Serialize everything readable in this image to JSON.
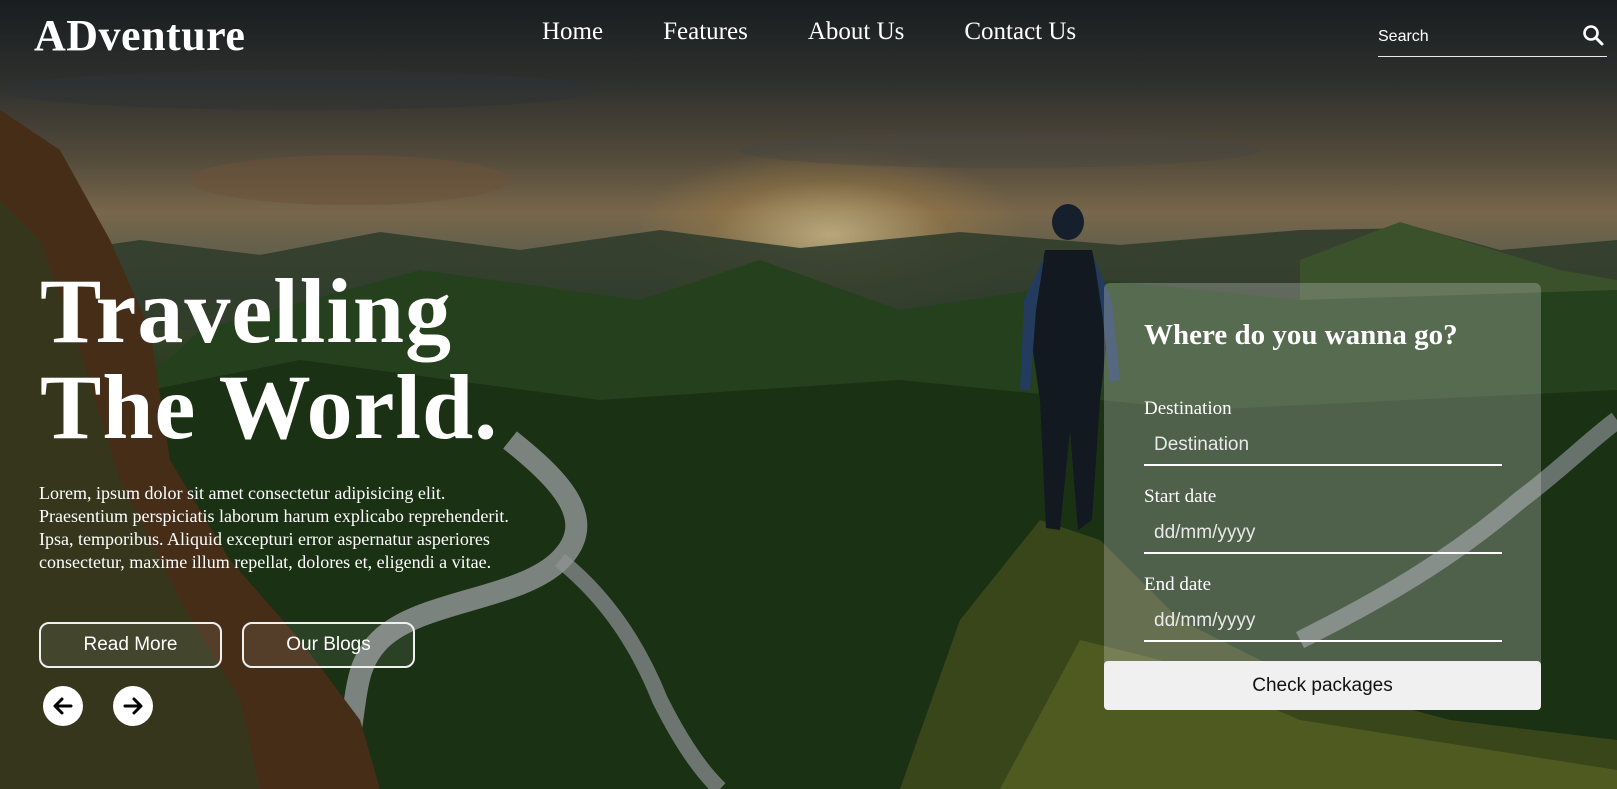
{
  "header": {
    "logo": "ADventure",
    "nav": [
      "Home",
      "Features",
      "About Us",
      "Contact Us"
    ],
    "search_placeholder": "Search"
  },
  "hero": {
    "title_line1": "Travelling",
    "title_line2": "The World.",
    "paragraph": "Lorem, ipsum dolor sit amet consectetur adipisicing elit. Praesentium perspiciatis laborum harum explicabo reprehenderit. Ipsa, temporibus. Aliquid excepturi error aspernatur asperiores consectetur, maxime illum repellat, dolores et, eligendi a vitae.",
    "read_more": "Read More",
    "our_blogs": "Our Blogs"
  },
  "booking": {
    "title": "Where do you wanna go?",
    "destination_label": "Destination",
    "destination_placeholder": "Destination",
    "start_label": "Start date",
    "start_placeholder": "dd/mm/yyyy",
    "end_label": "End date",
    "end_placeholder": "dd/mm/yyyy",
    "submit": "Check packages"
  },
  "icons": {
    "search": "search-icon",
    "prev": "arrow-left-icon",
    "next": "arrow-right-icon"
  },
  "colors": {
    "text": "#ffffff",
    "panel": "rgba(220,220,220,0.28)",
    "button": "#f0f0f0"
  }
}
